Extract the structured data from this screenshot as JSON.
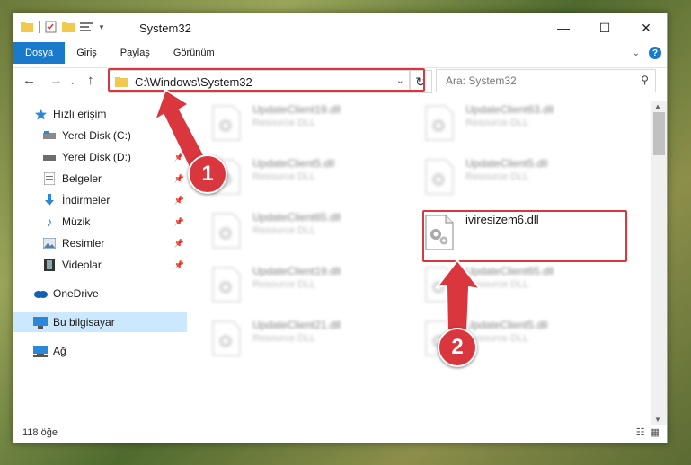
{
  "window": {
    "title": "System32"
  },
  "ribbon": {
    "tabs": [
      "Dosya",
      "Giriş",
      "Paylaş",
      "Görünüm"
    ],
    "active_tab": 0
  },
  "address": {
    "path": "C:\\Windows\\System32"
  },
  "search": {
    "placeholder": "Ara: System32"
  },
  "sidebar": {
    "items": [
      {
        "label": "Hızlı erişim",
        "icon": "star-icon",
        "pinned": false
      },
      {
        "label": "Yerel Disk (C:)",
        "icon": "drive-icon",
        "pinned": true
      },
      {
        "label": "Yerel Disk (D:)",
        "icon": "drive-icon",
        "pinned": true
      },
      {
        "label": "Belgeler",
        "icon": "document-icon",
        "pinned": true
      },
      {
        "label": "İndirmeler",
        "icon": "download-icon",
        "pinned": true
      },
      {
        "label": "Müzik",
        "icon": "music-icon",
        "pinned": true
      },
      {
        "label": "Resimler",
        "icon": "pictures-icon",
        "pinned": true
      },
      {
        "label": "Videolar",
        "icon": "video-icon",
        "pinned": true
      },
      {
        "label": "OneDrive",
        "icon": "cloud-icon",
        "pinned": false
      },
      {
        "label": "Bu bilgisayar",
        "icon": "computer-icon",
        "pinned": false
      },
      {
        "label": "Ağ",
        "icon": "network-icon",
        "pinned": false
      }
    ]
  },
  "files": [
    {
      "name": "UpdateClient19.dll",
      "type": "Resource DLL"
    },
    {
      "name": "UpdateClient63.dll",
      "type": "Resource DLL"
    },
    {
      "name": "UpdateClient5.dll",
      "type": "Resource DLL"
    },
    {
      "name": "UpdateClient5.dll",
      "type": "Resource DLL"
    },
    {
      "name": "UpdateClient65.dll",
      "type": "Resource DLL"
    },
    {
      "name": "iviresizem6.dll",
      "type": ""
    },
    {
      "name": "UpdateClient19.dll",
      "type": "Resource DLL"
    },
    {
      "name": "UpdateClient65.dll",
      "type": "Resource DLL"
    },
    {
      "name": "UpdateClient21.dll",
      "type": "Resource DLL"
    },
    {
      "name": "UpdateClient5.dll",
      "type": "Resource DLL"
    }
  ],
  "status": {
    "count": "118 öğe"
  },
  "annotations": {
    "step1": "1",
    "step2": "2",
    "color": "#d9363e"
  }
}
